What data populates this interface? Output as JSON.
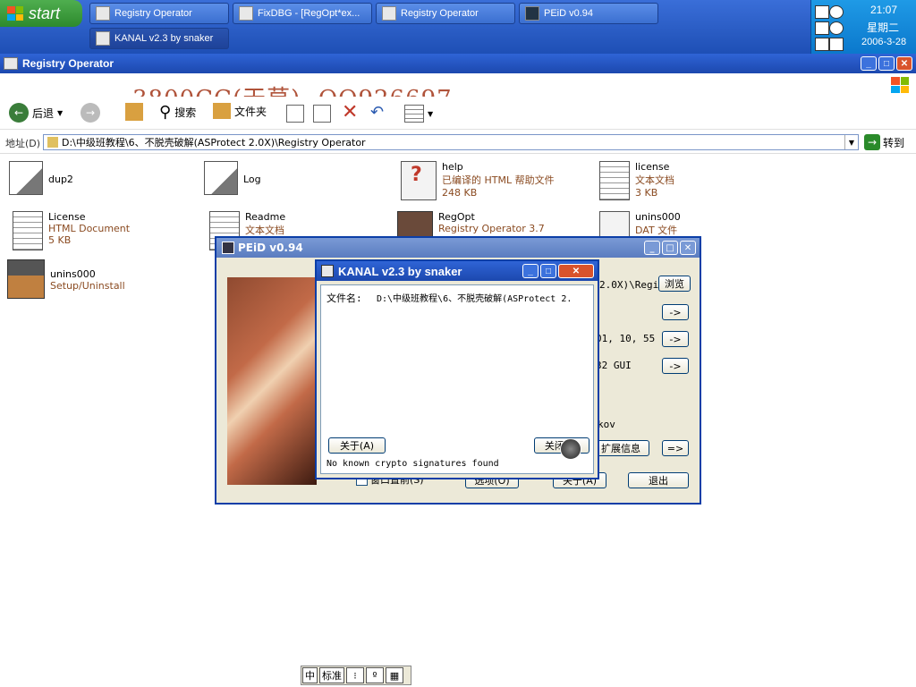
{
  "taskbar": {
    "start_label": "start",
    "tasks": [
      {
        "label": "Registry Operator"
      },
      {
        "label": "FixDBG - [RegOpt*ex..."
      },
      {
        "label": "Registry Operator"
      },
      {
        "label": "PEiD v0.94"
      },
      {
        "label": "KANAL v2.3 by snaker"
      }
    ],
    "clock": {
      "time": "21:07",
      "weekday": "星期二",
      "date": "2006-3-28"
    }
  },
  "explorer": {
    "title": "Registry Operator",
    "watermark": "3800CC(天草)--QQ926697",
    "toolbar": {
      "back": "后退",
      "search": "搜索",
      "folders": "文件夹"
    },
    "address": {
      "label": "地址(D)",
      "value": "D:\\中级班教程\\6、不脱壳破解(ASProtect 2.0X)\\Registry Operator",
      "go": "转到"
    },
    "files": [
      {
        "name": "dup2",
        "type": "",
        "size": ""
      },
      {
        "name": "Log",
        "type": "",
        "size": ""
      },
      {
        "name": "help",
        "type": "已编译的 HTML 帮助文件",
        "size": "248 KB"
      },
      {
        "name": "license",
        "type": "文本文档",
        "size": "3 KB"
      },
      {
        "name": "License",
        "type": "HTML Document",
        "size": "5 KB"
      },
      {
        "name": "Readme",
        "type": "文本文档",
        "size": ""
      },
      {
        "name": "RegOpt",
        "type": "Registry Operator 3.7",
        "size": ""
      },
      {
        "name": "unins000",
        "type": "DAT 文件",
        "size": ""
      },
      {
        "name": "unins000",
        "type": "Setup/Uninstall",
        "size": ""
      }
    ]
  },
  "peid": {
    "title": "PEiD v0.94",
    "path_fragment": "2.0X)\\Regi",
    "browse": "浏览",
    "arrow_btn": "->",
    "version_fragment": "01, 10, 55",
    "subsystem_fragment": "32 GUI",
    "author_fragment": "kov",
    "ext_info": "扩展信息",
    "more_btn": "=>",
    "stay_on_top": "窗口置前(S)",
    "options": "选项(O)",
    "about": "关于(A)",
    "exit": "退出"
  },
  "kanal": {
    "title": "KANAL v2.3 by snaker",
    "file_label": "文件名:",
    "file_value": "D:\\中级班教程\\6、不脱壳破解(ASProtect 2.",
    "about_btn": "关于(A)",
    "close_btn": "关闭(C)",
    "status": "No known crypto signatures found"
  },
  "ime": {
    "items": [
      "中",
      "标准"
    ]
  }
}
